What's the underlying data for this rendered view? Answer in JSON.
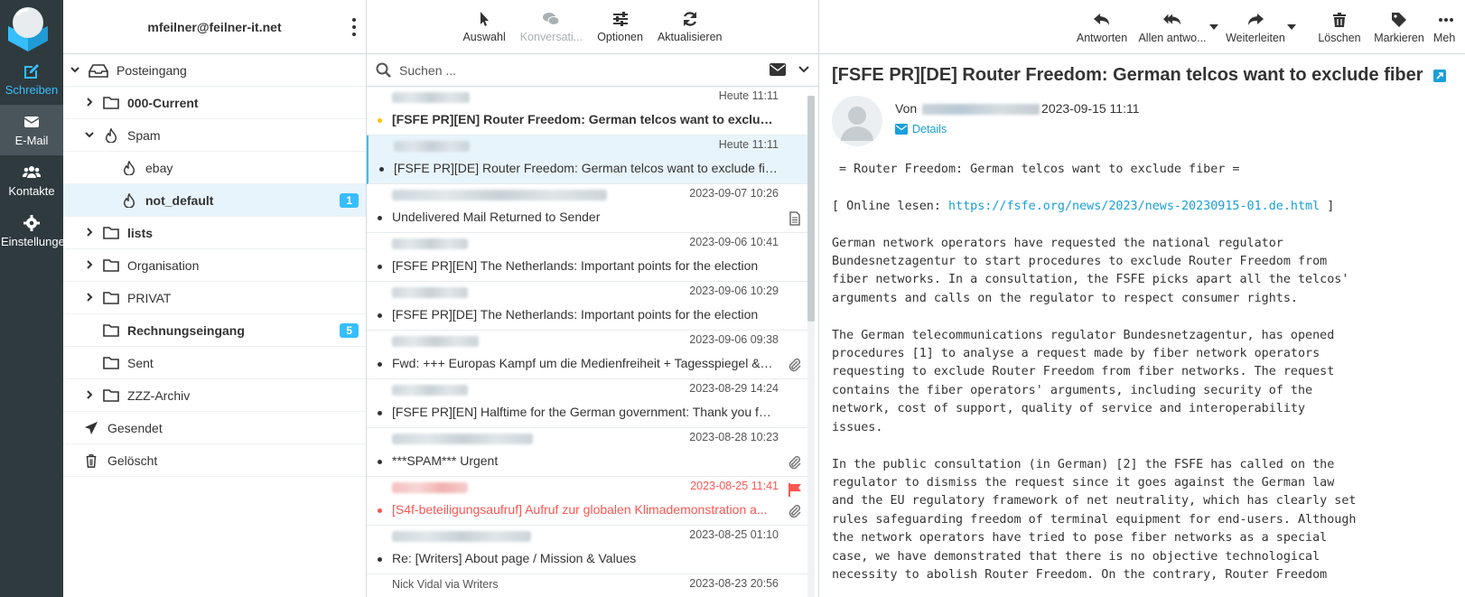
{
  "nav": {
    "compose": "Schreiben",
    "mail": "E-Mail",
    "contacts": "Kontakte",
    "settings": "Einstellungen"
  },
  "account": "mfeilner@feilner-it.net",
  "folders": [
    {
      "label": "Posteingang",
      "count": ""
    },
    {
      "label": "000-Current",
      "count": ""
    },
    {
      "label": "Spam",
      "count": ""
    },
    {
      "label": "ebay",
      "count": ""
    },
    {
      "label": "not_default",
      "count": "1"
    },
    {
      "label": "lists",
      "count": ""
    },
    {
      "label": "Organisation",
      "count": ""
    },
    {
      "label": "PRIVAT",
      "count": ""
    },
    {
      "label": "Rechnungseingang",
      "count": "5"
    },
    {
      "label": "Sent",
      "count": ""
    },
    {
      "label": "ZZZ-Archiv",
      "count": ""
    },
    {
      "label": "Gesendet",
      "count": ""
    },
    {
      "label": "Gelöscht",
      "count": ""
    }
  ],
  "list_toolbar": {
    "select": "Auswahl",
    "threads": "Konversati...",
    "options": "Optionen",
    "refresh": "Aktualisieren"
  },
  "search": {
    "placeholder": "Suchen ..."
  },
  "messages": [
    {
      "from": "",
      "date": "Heute 11:11",
      "subject": "[FSFE PR][EN] Router Freedom: German telcos want to exclude fib..."
    },
    {
      "from": "",
      "date": "Heute 11:11",
      "subject": "[FSFE PR][DE] Router Freedom: German telcos want to exclude fiber"
    },
    {
      "from": "",
      "date": "2023-09-07 10:26",
      "subject": "Undelivered Mail Returned to Sender"
    },
    {
      "from": "",
      "date": "2023-09-06 10:41",
      "subject": "[FSFE PR][EN] The Netherlands: Important points for the election"
    },
    {
      "from": "",
      "date": "2023-09-06 10:29",
      "subject": "[FSFE PR][DE] The Netherlands: Important points for the election"
    },
    {
      "from": "",
      "date": "2023-09-06 09:38",
      "subject": "Fwd: +++ Europas Kampf um die Medienfreiheit + Tagesspiegel & I..."
    },
    {
      "from": "",
      "date": "2023-08-29 14:24",
      "subject": "[FSFE PR][EN] Halftime for the German government: Thank you for ..."
    },
    {
      "from": "",
      "date": "2023-08-28 10:23",
      "subject": "***SPAM*** Urgent"
    },
    {
      "from": "",
      "date": "2023-08-25 11:41",
      "subject": "[S4f-beteiligungsaufruf] Aufruf zur globalen Klimademonstration a..."
    },
    {
      "from": "",
      "date": "2023-08-25 01:10",
      "subject": "Re: [Writers] About page / Mission & Values"
    },
    {
      "from": "Nick Vidal via Writers",
      "date": "2023-08-23 20:56",
      "subject": ""
    }
  ],
  "reader_toolbar": {
    "reply": "Antworten",
    "reply_all": "Allen antwo...",
    "forward": "Weiterleiten",
    "delete": "Löschen",
    "mark": "Markieren",
    "more": "Meh"
  },
  "reader": {
    "subject": "[FSFE PR][DE] Router Freedom: German telcos want to exclude fiber",
    "from_prefix": "Von",
    "date": "2023-09-15 11:11",
    "details": "Details",
    "body_intro": " = Router Freedom: German telcos want to exclude fiber =",
    "online_prefix": "[ Online lesen: ",
    "online_url": "https://fsfe.org/news/2023/news-20230915-01.de.html",
    "online_suffix": " ]",
    "body_p1": "German network operators have requested the national regulator\nBundesnetzagentur to start procedures to exclude Router Freedom from\nfiber networks. In a consultation, the FSFE picks apart all the telcos'\narguments and calls on the regulator to respect consumer rights.",
    "body_p2": "The German telecommunications regulator Bundesnetzagentur, has opened\nprocedures [1] to analyse a request made by fiber network operators\nrequesting to exclude Router Freedom from fiber networks. The request\ncontains the fiber operators' arguments, including security of the\nnetwork, cost of support, quality of service and interoperability\nissues.",
    "body_p3": "In the public consultation (in German) [2] the FSFE has called on the\nregulator to dismiss the request since it goes against the German law\nand the EU regulatory framework of net neutrality, which has clearly set\nrules safeguarding freedom of terminal equipment for end-users. Although\nthe network operators have tried to pose fiber networks as a special\ncase, we have demonstrated that there is no objective technological\nnecessity to abolish Router Freedom. On the contrary, Router Freedom"
  },
  "colors": {
    "accent": "#37beff",
    "rail": "#2f3a3f",
    "flagged": "#ff5552",
    "unread_dot": "#ffc107"
  }
}
